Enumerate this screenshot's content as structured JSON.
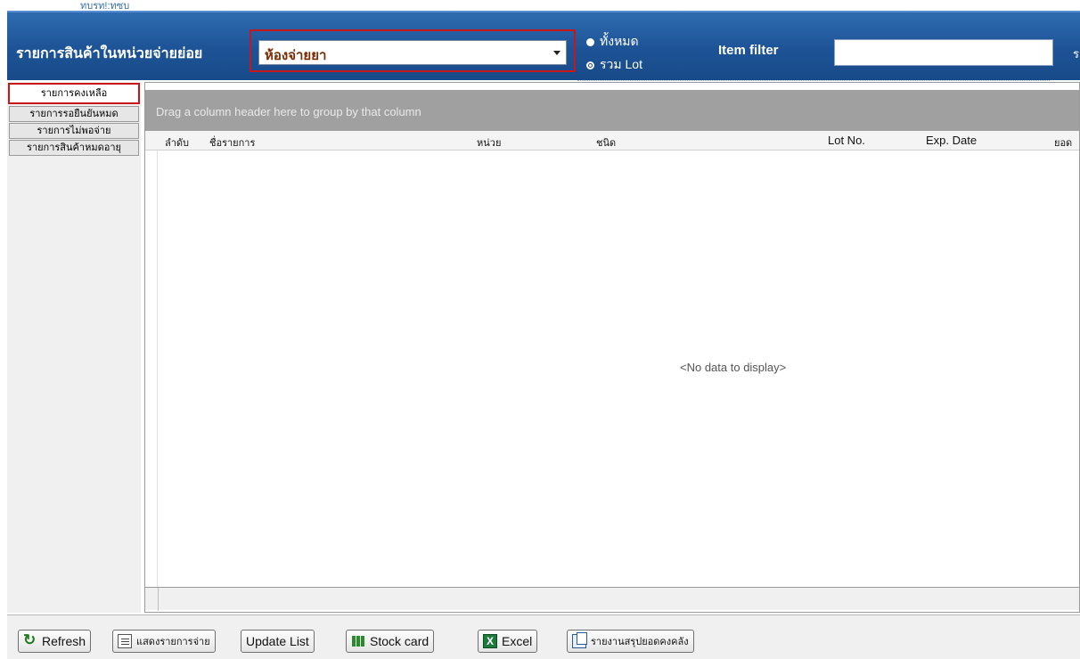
{
  "window": {
    "title_fragment": "ทบรท!:ทซบ"
  },
  "header": {
    "title": "รายการสินค้าในหน่วยจ่ายย่อย",
    "unit_combo": {
      "value": "ห้องจ่ายยา"
    },
    "radio_all_label": "ทั้งหมด",
    "radio_lot_label": "รวม Lot",
    "item_filter_label": "Item filter",
    "item_filter_value": "",
    "right_glyph": "ร"
  },
  "sidebar": {
    "tabs": [
      {
        "label": "รายการคงเหลือ",
        "active": true
      },
      {
        "label": "รายการรอยืนยันหมด",
        "active": false
      },
      {
        "label": "รายการไม่พอจ่าย",
        "active": false
      },
      {
        "label": "รายการสินค้าหมดอายุ",
        "active": false
      }
    ]
  },
  "grid": {
    "group_hint": "Drag a column header here to group by that column",
    "columns": [
      "ลำดับ",
      "ชื่อรายการ",
      "หน่วย",
      "ชนิด",
      "Lot No.",
      "Exp. Date",
      "ยอด"
    ],
    "empty_text": "<No data to display>"
  },
  "toolbar": {
    "refresh_label": "Refresh",
    "show_dispense_label": "แสดงรายการจ่าย",
    "update_list_label": "Update List",
    "stock_card_label": "Stock card",
    "excel_label": "Excel",
    "summary_report_label": "รายงานสรุปยอดคงคลัง"
  },
  "icons": {
    "refresh": "refresh-icon",
    "list": "list-icon",
    "stock": "stock-card-icon",
    "excel": "excel-icon",
    "report": "report-icon"
  },
  "colors": {
    "header_blue": "#1d5396",
    "highlight_red": "#c8161a",
    "group_panel_gray": "#a0a0a0"
  }
}
